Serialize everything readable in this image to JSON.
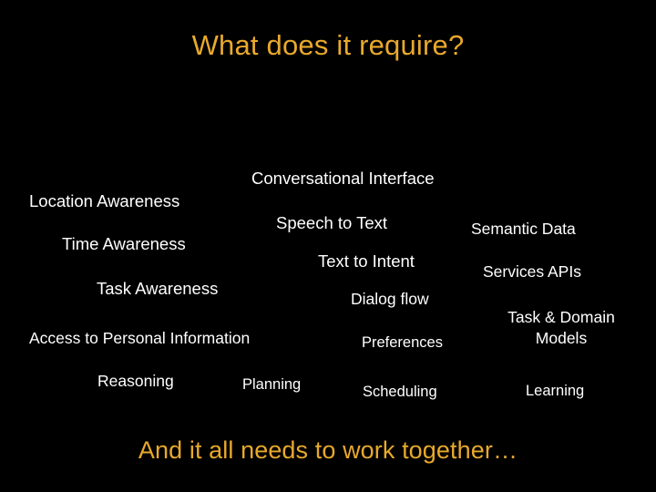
{
  "slide": {
    "background_color": "#000000",
    "accent_color": "#e8a92c",
    "body_text_color": "#ffffff",
    "title": "What does it require?",
    "footer": "And it all needs to work together…"
  },
  "requirements": [
    {
      "id": "conversational-interface",
      "label": "Conversational Interface"
    },
    {
      "id": "location-awareness",
      "label": "Location Awareness"
    },
    {
      "id": "speech-to-text",
      "label": "Speech to Text"
    },
    {
      "id": "semantic-data",
      "label": "Semantic Data"
    },
    {
      "id": "time-awareness",
      "label": "Time Awareness"
    },
    {
      "id": "text-to-intent",
      "label": "Text to Intent"
    },
    {
      "id": "services-apis",
      "label": "Services APIs"
    },
    {
      "id": "task-awareness",
      "label": "Task Awareness"
    },
    {
      "id": "dialog-flow",
      "label": "Dialog flow"
    },
    {
      "id": "task-domain-models",
      "label": "Task & Domain\nModels"
    },
    {
      "id": "access-personal-info",
      "label": "Access to Personal Information"
    },
    {
      "id": "preferences",
      "label": "Preferences"
    },
    {
      "id": "reasoning",
      "label": "Reasoning"
    },
    {
      "id": "planning",
      "label": "Planning"
    },
    {
      "id": "scheduling",
      "label": "Scheduling"
    },
    {
      "id": "learning",
      "label": "Learning"
    }
  ]
}
